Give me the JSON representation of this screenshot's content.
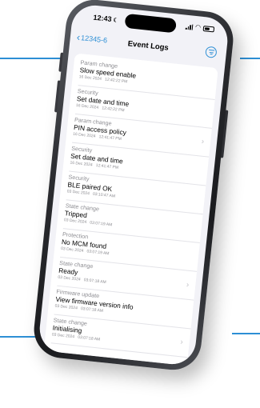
{
  "status_bar": {
    "time": "12:43"
  },
  "nav": {
    "back_label": "12345-6",
    "title": "Event Logs"
  },
  "logs": [
    {
      "category": "Param change",
      "title": "Slow speed enable",
      "date": "16 Dec 2024",
      "time": "12:42:22 PM",
      "has_chevron": false
    },
    {
      "category": "Security",
      "title": "Set date and time",
      "date": "16 Dec 2024",
      "time": "12:42:22 PM",
      "has_chevron": false
    },
    {
      "category": "Param change",
      "title": "PIN access policy",
      "date": "16 Dec 2024",
      "time": "12:41:47 PM",
      "has_chevron": true
    },
    {
      "category": "Security",
      "title": "Set date and time",
      "date": "16 Dec 2024",
      "time": "12:41:47 PM",
      "has_chevron": false
    },
    {
      "category": "Security",
      "title": "BLE paired OK",
      "date": "03 Dec 2024",
      "time": "03:10:47 AM",
      "has_chevron": false
    },
    {
      "category": "State change",
      "title": "Tripped",
      "date": "03 Dec 2024",
      "time": "03:07:19 AM",
      "has_chevron": false
    },
    {
      "category": "Protection",
      "title": "No MCM found",
      "date": "03 Dec 2024",
      "time": "03:07:19 AM",
      "has_chevron": false
    },
    {
      "category": "State change",
      "title": "Ready",
      "date": "03 Dec 2024",
      "time": "03:07:18 AM",
      "has_chevron": true
    },
    {
      "category": "Firmware update",
      "title": "View firmware version info",
      "date": "03 Dec 2024",
      "time": "03:07:18 AM",
      "has_chevron": false
    },
    {
      "category": "State change",
      "title": "Initialising",
      "date": "03 Dec 2024",
      "time": "03:07:18 AM",
      "has_chevron": true
    }
  ],
  "icons": {
    "back": "chevron-left-icon",
    "filter": "filter-icon",
    "row": "chevron-right-icon",
    "signal": "signal-icon",
    "wifi": "wifi-icon",
    "battery": "battery-icon"
  },
  "colors": {
    "accent": "#2d8fd5",
    "background": "#f2f2f7",
    "secondary_text": "#8e8e93"
  }
}
